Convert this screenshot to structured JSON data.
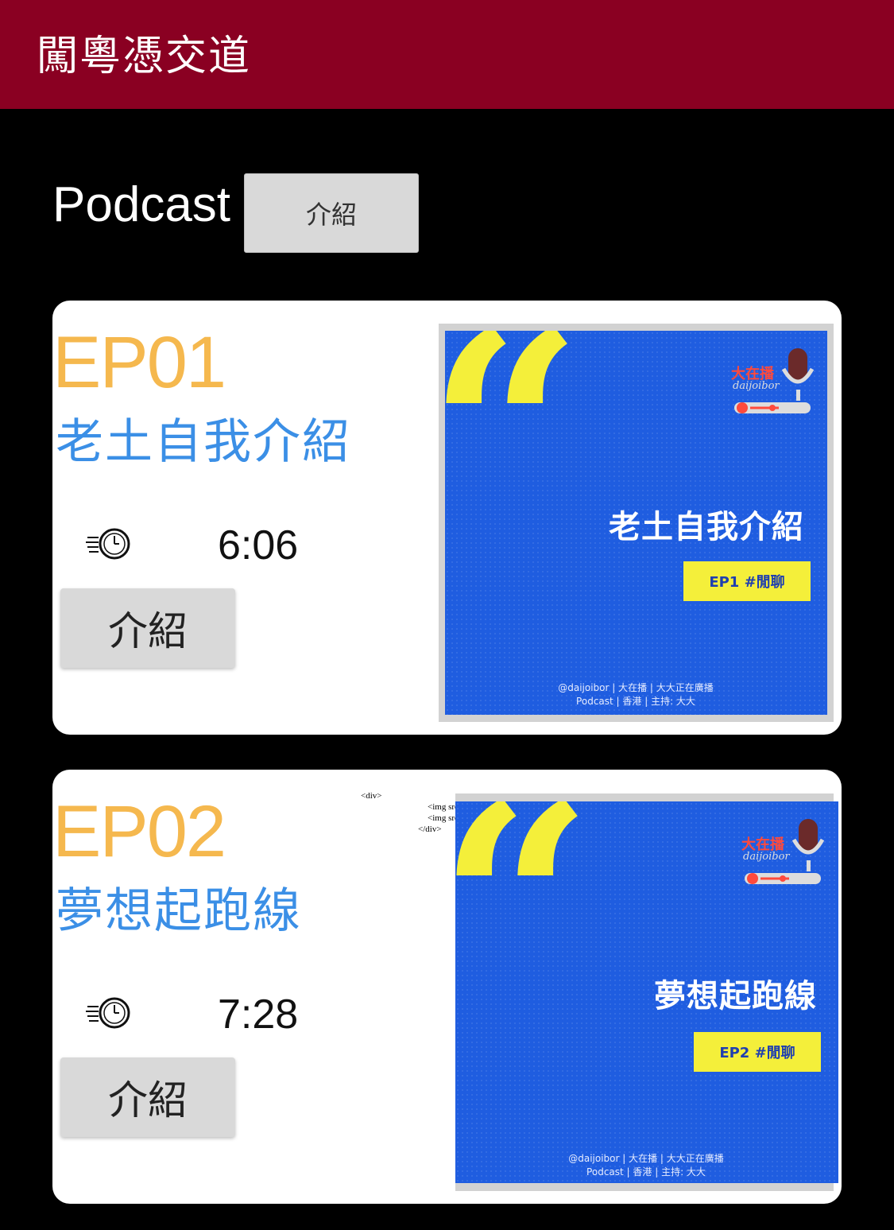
{
  "header": {
    "app_title": "闖粵憑交道"
  },
  "section": {
    "heading": "Podcast",
    "intro_button": "介紹"
  },
  "episodes": [
    {
      "number": "EP01",
      "title": "老土自我介紹",
      "duration": "6:06",
      "intro_label": "介紹",
      "cover": {
        "title": "老土自我介紹",
        "tag": "EP1 #閒聊",
        "logo_text": "大在播",
        "logo_sub": "daijoibor",
        "footer_line1": "@daijoibor | 大在播 | 大大正在廣播",
        "footer_line2": "Podcast | 香港 | 主持: 大大"
      }
    },
    {
      "number": "EP02",
      "title": "夢想起跑線",
      "duration": "7:28",
      "intro_label": "介紹",
      "cover": {
        "title": "夢想起跑線",
        "tag": "EP2 #閒聊",
        "logo_text": "大在播",
        "logo_sub": "daijoibor",
        "footer_line1": "@daijoibor | 大在播 | 大大正在廣播",
        "footer_line2": "Podcast | 香港 | 主持: 大大"
      }
    }
  ],
  "code_fragment": {
    "line1": "<div>",
    "line2": "<img src=\"images/music.png\">",
    "line3": "<img src=\"images/musicpar.png\">",
    "line4": "</div>"
  },
  "colors": {
    "topbar": "#8a0022",
    "ep_number": "#f5b84e",
    "ep_title": "#3b8fe6",
    "cover_blue": "#1f5de0",
    "cover_yellow": "#f4ef3a"
  }
}
